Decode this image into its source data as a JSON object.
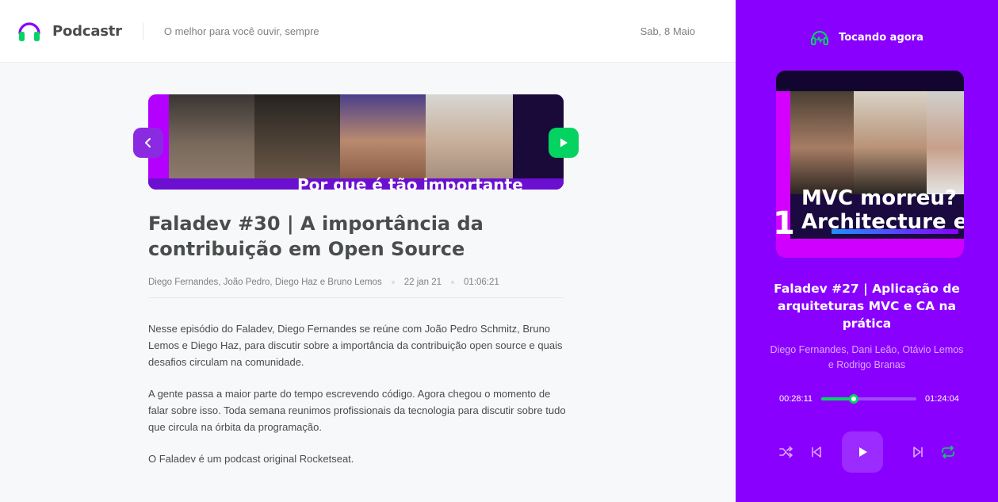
{
  "app": {
    "name": "Podcastr",
    "tagline": "O melhor para você ouvir, sempre",
    "date": "Sab, 8 Maio"
  },
  "episode": {
    "thumbnail_text": "Por que é tão importante",
    "title": "Faladev #30 | A importância da contribuição em Open Source",
    "members": "Diego Fernandes, João Pedro, Diego Haz e Bruno Lemos",
    "published": "22 jan 21",
    "duration": "01:06:21",
    "description": [
      "Nesse episódio do Faladev, Diego Fernandes se reúne com João Pedro Schmitz, Bruno Lemos e Diego Haz, para discutir sobre a importância da contribuição open source e quais desafios circulam na comunidade.",
      "A gente passa a maior parte do tempo escrevendo código. Agora chegou o momento de falar sobre isso. Toda semana reunimos profissionais da tecnologia para discutir sobre tudo que circula na órbita da programação.",
      "O Faladev é um podcast original Rocketseat."
    ]
  },
  "player": {
    "heading": "Tocando agora",
    "cover_text_line1": "MVC morreu? C",
    "cover_text_line2": "Architecture e",
    "cover_number": "1",
    "title": "Faladev #27 | Aplicação de arquiteturas MVC e CA na prática",
    "members": "Diego Fernandes, Dani Leão, Otávio Lemos e Rodrigo Branas",
    "current_time": "00:28:11",
    "total_time": "01:24:04",
    "progress": 0.34,
    "controls": [
      "shuffle-icon",
      "previous-icon",
      "play-icon",
      "next-icon",
      "repeat-icon"
    ]
  },
  "colors": {
    "brand_purple": "#8a00ff",
    "green": "#04d361",
    "text_dark": "#494d4b",
    "text_muted": "#808080"
  }
}
